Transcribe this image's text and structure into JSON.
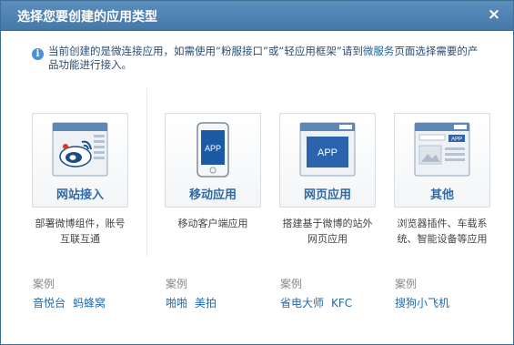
{
  "dialog": {
    "title": "选择您要创建的应用类型",
    "close_glyph": "×"
  },
  "notice": {
    "text_before": "当前创建的是微连接应用，如需使用“粉服接口”或“轻应用框架”请到",
    "link": "微服务",
    "text_after": "页面选择需要的产品功能进行接入。"
  },
  "options": [
    {
      "label": "网站接入",
      "desc_line1": "部署微博组件，账号",
      "desc_line2": "互联互通",
      "icon": "weibo-website-icon"
    },
    {
      "label": "移动应用",
      "desc_line1": "移动客户端应用",
      "desc_line2": "",
      "icon": "mobile-app-icon",
      "badge": "APP"
    },
    {
      "label": "网页应用",
      "desc_line1": "搭建基于微博的站外",
      "desc_line2": "网页应用",
      "icon": "web-app-icon",
      "badge": "APP"
    },
    {
      "label": "其他",
      "desc_line1": "浏览器插件、车载系",
      "desc_line2": "统、智能设备等应用",
      "icon": "other-app-icon",
      "badge": "APP"
    }
  ],
  "cases": {
    "label": "案例",
    "groups": [
      [
        "音悦台",
        "蚂蜂窝"
      ],
      [
        "啪啪",
        "美拍"
      ],
      [
        "省电大师",
        "KFC"
      ],
      [
        "搜狗小飞机"
      ]
    ]
  },
  "colors": {
    "title_bar": "#4a7eae",
    "link": "#1e6ab0",
    "card_label": "#2f6aa6"
  }
}
